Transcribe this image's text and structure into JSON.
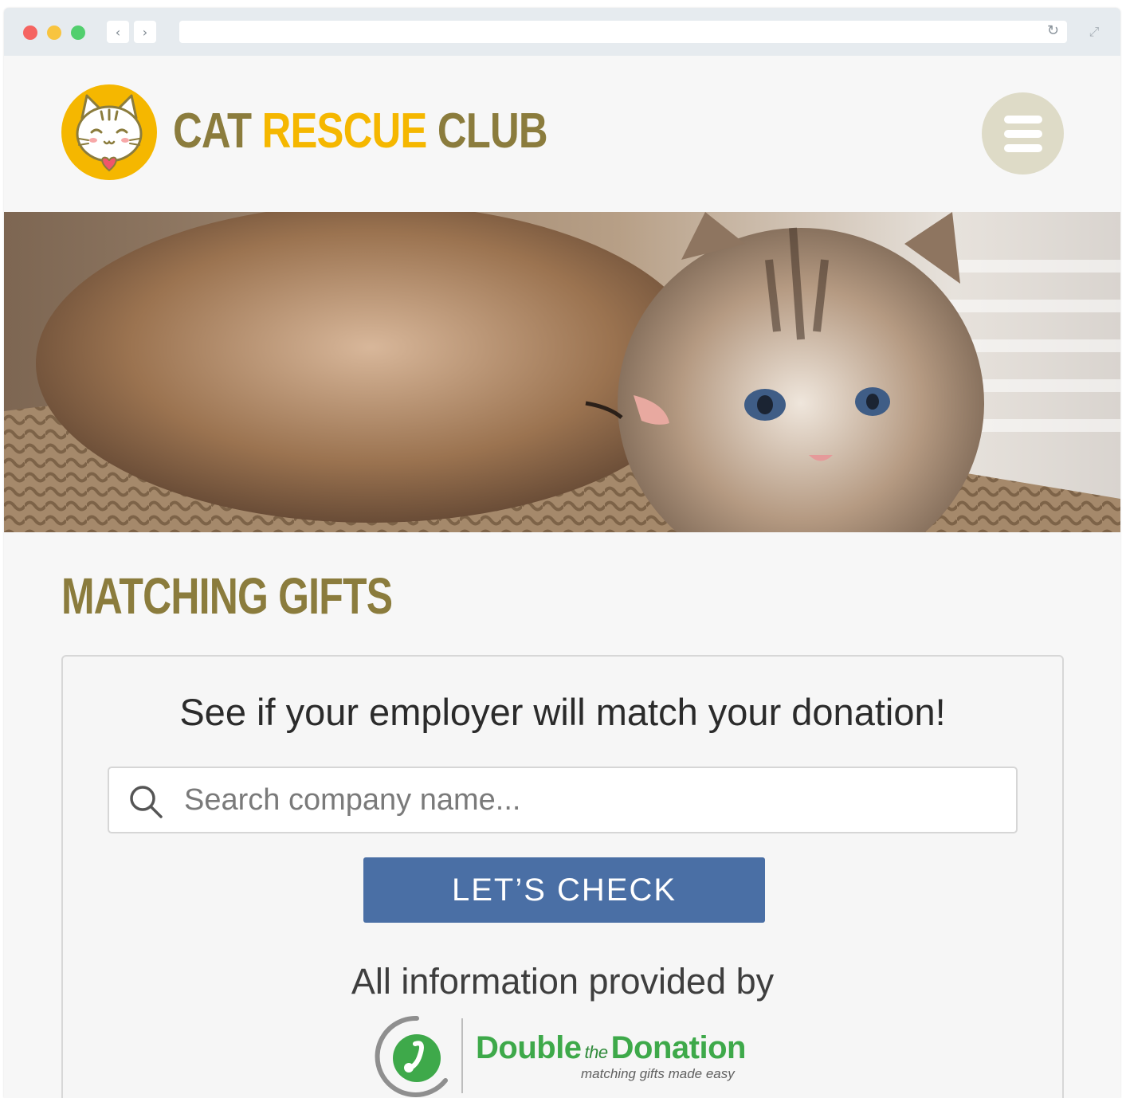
{
  "browser": {
    "back_glyph": "‹",
    "forward_glyph": "›",
    "reload_glyph": "↻",
    "expand_glyph": "⤢",
    "url": ""
  },
  "header": {
    "brand_word1": "CAT",
    "brand_word2": "RESCUE",
    "brand_word3": "CLUB",
    "logo_icon": "cat-face-icon",
    "menu_icon": "hamburger-menu-icon"
  },
  "hero": {
    "image_subject": "two kittens"
  },
  "main": {
    "title": "MATCHING GIFTS",
    "widget": {
      "heading": "See if your employer will match your donation!",
      "search_placeholder": "Search company name...",
      "search_value": "",
      "button_label": "LET’S CHECK",
      "provided_by": "All information provided by",
      "provider": {
        "name_part1": "Double",
        "name_connector": "the",
        "name_part2": "Donation",
        "tagline": "matching gifts made easy"
      }
    }
  },
  "colors": {
    "brand_olive": "#8b7c3d",
    "brand_gold": "#f5b700",
    "button_blue": "#4a6fa5",
    "provider_green": "#3ea94a",
    "menu_circle": "#dedbc7"
  }
}
